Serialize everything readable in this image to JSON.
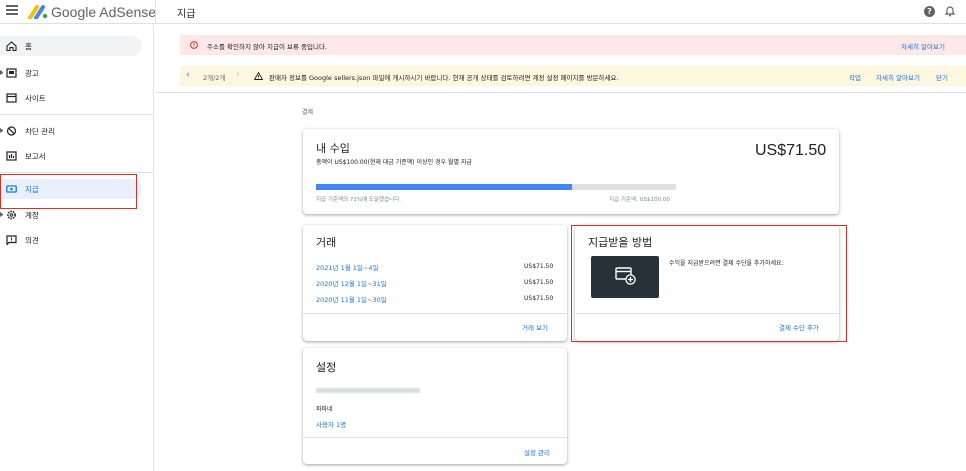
{
  "app": {
    "logo_text": "Google AdSense",
    "page_title": "지급"
  },
  "sidebar": {
    "items": [
      {
        "label": "홈",
        "icon": "home-icon"
      },
      {
        "label": "광고",
        "icon": "ads-icon"
      },
      {
        "label": "사이트",
        "icon": "sites-icon"
      },
      {
        "label": "차단 관리",
        "icon": "block-icon"
      },
      {
        "label": "보고서",
        "icon": "reports-icon"
      },
      {
        "label": "지급",
        "icon": "payments-icon"
      },
      {
        "label": "계정",
        "icon": "account-gear-icon"
      },
      {
        "label": "의견",
        "icon": "feedback-icon"
      }
    ]
  },
  "banners": {
    "red": {
      "text": "주소를 확인하지 않아 지급이 보류 중입니다.",
      "link": "자세히 알아보기"
    },
    "yellow": {
      "pager": "2개/2개",
      "text": "판매자 정보를 Google sellers.json 파일에 게시하시기 바랍니다. 현재 공개 상태를 검토하려면 계정 설정 페이지를 방문하세요.",
      "action": "작업",
      "learn": "자세히 알아보기",
      "close": "닫기"
    }
  },
  "breadcrumb": "결제",
  "earnings": {
    "title": "내 수입",
    "subtitle": "총액이 US$100.00(현재 대금 기준액) 이상인 경우 월별 지급",
    "amount": "US$71.50",
    "progress_percent": 71,
    "progress_label": "지급 기준액의 71%에 도달했습니다.",
    "threshold_label": "지급 기준액: US$100.00"
  },
  "transactions": {
    "title": "거래",
    "rows": [
      {
        "period": "2021년 1월 1일~4일",
        "amount": "US$71.50"
      },
      {
        "period": "2020년 12월 1일~31일",
        "amount": "US$71.50"
      },
      {
        "period": "2020년 11월 1일~30일",
        "amount": "US$71.50"
      }
    ],
    "view_link": "거래 보기"
  },
  "payment_method": {
    "title": "지급받을 방법",
    "desc": "수익을 지급받으려면 결제 수단을 추가하세요.",
    "add_link": "결제 수단 추가"
  },
  "settings": {
    "title": "설정",
    "name": "파파네",
    "users_link": "사용자 1명",
    "manage_link": "설정 관리"
  },
  "colors": {
    "accent": "#1a73e8",
    "progress": "#4285f4",
    "alert_red_bg": "#fce8e6",
    "alert_yellow_bg": "#fef7e0",
    "highlight": "#d93025"
  }
}
